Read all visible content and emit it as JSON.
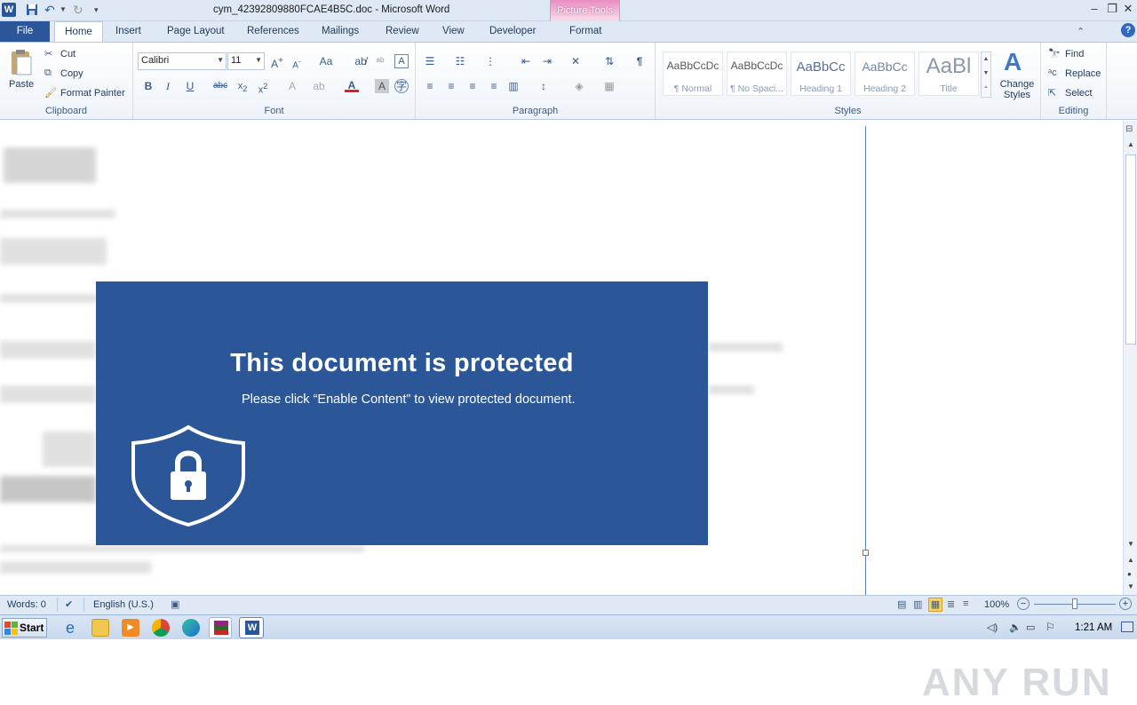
{
  "window": {
    "title": "cym_42392809880FCAE4B5C.doc - Microsoft Word",
    "context_tab_group": "Picture Tools"
  },
  "tabs": [
    "File",
    "Home",
    "Insert",
    "Page Layout",
    "References",
    "Mailings",
    "Review",
    "View",
    "Developer",
    "Format"
  ],
  "ribbon": {
    "clipboard": {
      "paste": "Paste",
      "cut": "Cut",
      "copy": "Copy",
      "format_painter": "Format Painter",
      "label": "Clipboard"
    },
    "font": {
      "name": "Calibri",
      "size": "11",
      "label": "Font"
    },
    "paragraph": {
      "label": "Paragraph"
    },
    "styles": {
      "items": [
        {
          "preview": "AaBbCcDc",
          "name": "¶ Normal"
        },
        {
          "preview": "AaBbCcDc",
          "name": "¶ No Spaci..."
        },
        {
          "preview": "AaBbCc",
          "name": "Heading 1"
        },
        {
          "preview": "AaBbCc",
          "name": "Heading 2"
        },
        {
          "preview": "AaBl",
          "name": "Title"
        }
      ],
      "change_styles": "Change Styles",
      "label": "Styles"
    },
    "editing": {
      "find": "Find",
      "replace": "Replace",
      "select": "Select",
      "label": "Editing"
    }
  },
  "document": {
    "banner_heading": "This document is protected",
    "banner_subtext": "Please click “Enable Content” to view protected document."
  },
  "status": {
    "words": "Words: 0",
    "language": "English (U.S.)",
    "zoom": "100%"
  },
  "taskbar": {
    "start": "Start",
    "time": "1:21 AM"
  },
  "watermark": "ANY RUN",
  "colors": {
    "banner": "#2b5798",
    "file_tab": "#2b579a",
    "context_tab": "#e98cc1"
  }
}
